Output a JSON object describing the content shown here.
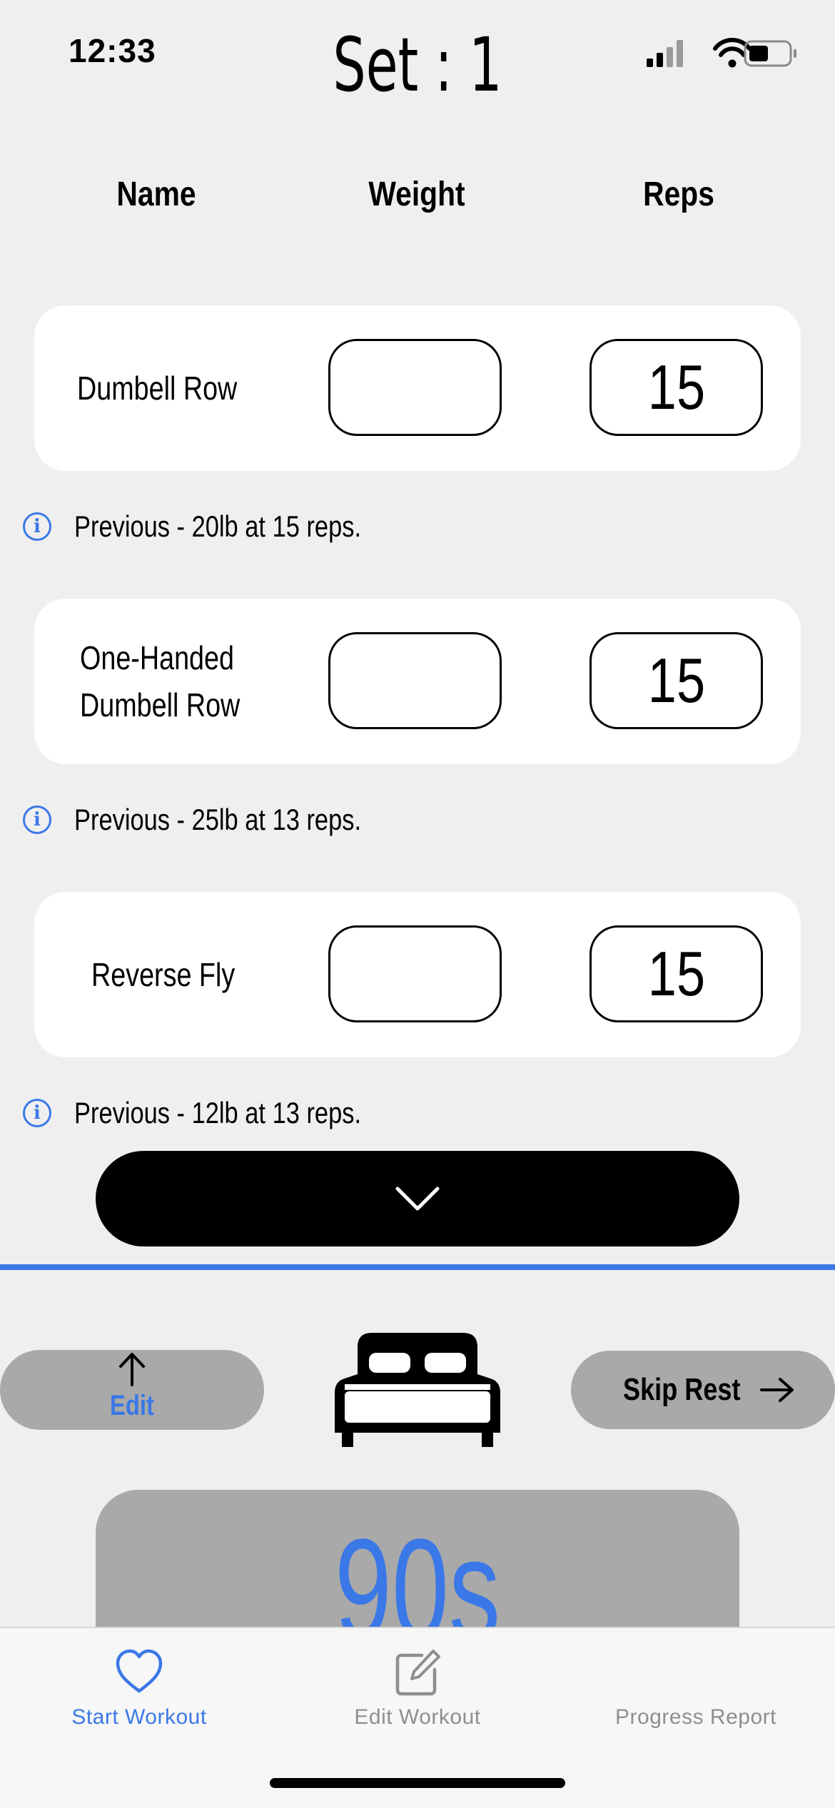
{
  "status_bar": {
    "time": "12:33"
  },
  "header": {
    "title": "Set : 1"
  },
  "columns": {
    "name": "Name",
    "weight": "Weight",
    "reps": "Reps"
  },
  "exercises": [
    {
      "name_line1": "Dumbell Row",
      "name_line2": "",
      "weight": "",
      "reps": "15",
      "previous": "Previous - 20lb at 15 reps."
    },
    {
      "name_line1": "One-Handed",
      "name_line2": "Dumbell Row",
      "weight": "",
      "reps": "15",
      "previous": "Previous - 25lb at 13 reps."
    },
    {
      "name_line1": "Reverse Fly",
      "name_line2": "",
      "weight": "",
      "reps": "15",
      "previous": "Previous - 12lb at 13 reps."
    }
  ],
  "rest": {
    "edit_label": "Edit",
    "skip_label": "Skip Rest",
    "timer": "90s",
    "icon": "bed-icon"
  },
  "tabs": [
    {
      "label": "Start Workout",
      "icon": "heart-icon",
      "active": true
    },
    {
      "label": "Edit Workout",
      "icon": "edit-icon",
      "active": false
    },
    {
      "label": "Progress Report",
      "icon": "none",
      "active": false
    }
  ],
  "colors": {
    "accent": "#3b78e7",
    "background": "#efefef",
    "pill": "#a9a9a9",
    "inactive_tab": "#8e8e93"
  }
}
